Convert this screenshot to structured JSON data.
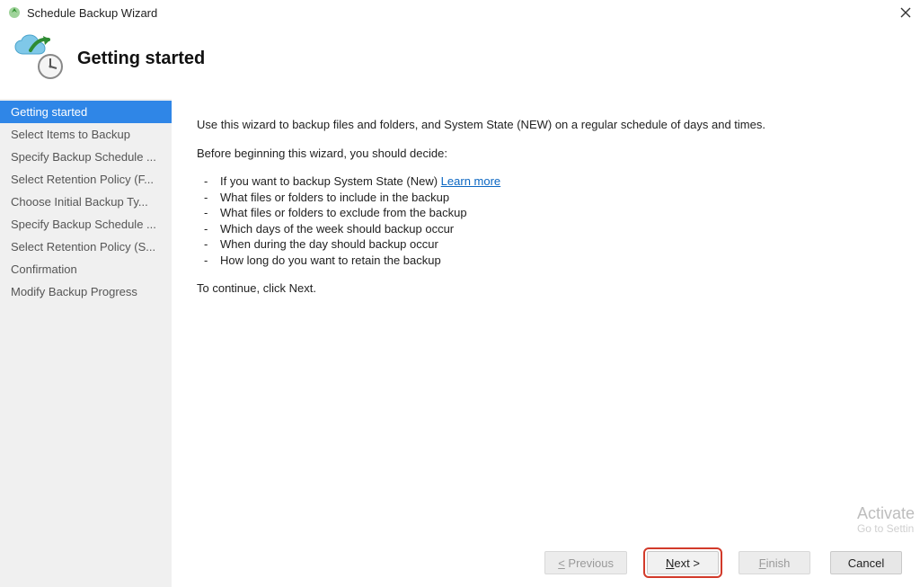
{
  "window": {
    "title": "Schedule Backup Wizard"
  },
  "header": {
    "title": "Getting started"
  },
  "sidebar": {
    "items": [
      {
        "label": "Getting started",
        "active": true
      },
      {
        "label": "Select Items to Backup",
        "active": false
      },
      {
        "label": "Specify Backup Schedule ...",
        "active": false
      },
      {
        "label": "Select Retention Policy (F...",
        "active": false
      },
      {
        "label": "Choose Initial Backup Ty...",
        "active": false
      },
      {
        "label": "Specify Backup Schedule ...",
        "active": false
      },
      {
        "label": "Select Retention Policy (S...",
        "active": false
      },
      {
        "label": "Confirmation",
        "active": false
      },
      {
        "label": "Modify Backup Progress",
        "active": false
      }
    ]
  },
  "content": {
    "intro": "Use this wizard to backup files and folders, and System State (NEW) on a regular schedule of days and times.",
    "decide_heading": "Before beginning this wizard, you should decide:",
    "bullets": [
      {
        "prefix": "If you want to backup System State (New) ",
        "link_text": "Learn more"
      },
      {
        "prefix": "What files or folders to include in the backup"
      },
      {
        "prefix": "What files or folders to exclude from the backup"
      },
      {
        "prefix": "Which days of the week should backup occur"
      },
      {
        "prefix": "When during the day should backup occur"
      },
      {
        "prefix": "How long do you want to retain the backup"
      }
    ],
    "continue_text": "To continue, click Next."
  },
  "footer": {
    "previous": "< Previous",
    "next": "Next >",
    "finish": "Finish",
    "cancel": "Cancel"
  },
  "watermark": {
    "line1": "Activate",
    "line2": "Go to Settin"
  }
}
